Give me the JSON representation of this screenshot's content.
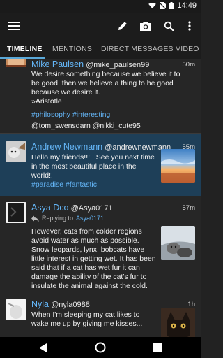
{
  "status_bar": {
    "time": "14:49"
  },
  "app_bar": {
    "menu_icon": "hamburger-menu-icon",
    "actions": [
      "compose-icon",
      "camera-icon",
      "search-icon",
      "more-vert-icon"
    ]
  },
  "tabs": [
    {
      "label": "TIMELINE",
      "active": true
    },
    {
      "label": "MENTIONS",
      "active": false
    },
    {
      "label": "DIRECT MESSAGES",
      "active": false
    },
    {
      "label": "VIDEO S",
      "active": false
    }
  ],
  "tweets": [
    {
      "name": "Mike Paulsen",
      "handle": "@mike_paulsen99",
      "time": "50m",
      "text": "We desire something because we believe it to be good, then we believe a thing to be good because we desire it.",
      "attribution": "»Aristotle",
      "hashtags": "#philosophy #interesting",
      "mentions": "@tom_swensdarn @nikki_cute95"
    },
    {
      "name": "Andrew Newmann",
      "handle": "@andrewnewmann",
      "time": "55m",
      "text": "Hello my friends!!!!! See you next time in the most beautiful place in the world!!",
      "hashtags": "#paradise #fantastic"
    },
    {
      "name": "Asya Dco",
      "handle": "@Asya0171",
      "time": "57m",
      "reply_label": "Replying to",
      "reply_to": "Asya0171",
      "text": "However, cats from colder regions avoid water as much as possible. Snow leopards, lynx, bobcats have little interest in getting wet. It has been said that if a cat has wet fur it can damage the ability of the cat's fur to insulate the animal against the cold."
    },
    {
      "name": "Nyla",
      "handle": "@nyla0988",
      "time": "1h",
      "text": "When I'm sleeping my cat likes to wake me up by giving me kisses..."
    }
  ],
  "nav_bar": [
    "back-icon",
    "home-icon",
    "recents-icon"
  ],
  "colors": {
    "accent": "#64b5f6",
    "highlight_row": "#1e3f58",
    "background": "#262626"
  }
}
